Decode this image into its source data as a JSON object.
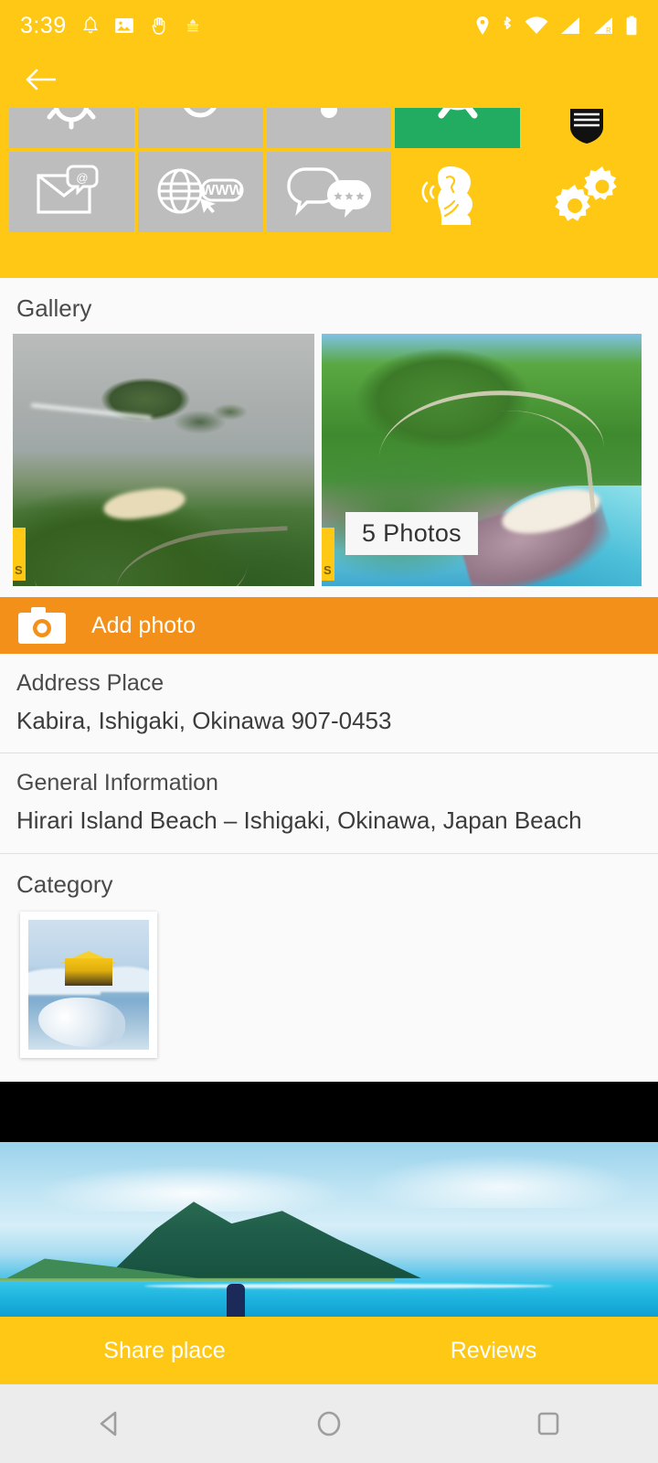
{
  "status_bar": {
    "time": "3:39",
    "left_icons": [
      "bell-icon",
      "image-icon",
      "hand-icon",
      "mosque-app-icon"
    ],
    "right_icons": [
      "location-pin-icon",
      "bluetooth-icon",
      "wifi-icon",
      "signal-icon",
      "signal-roaming-icon",
      "battery-icon"
    ],
    "roaming_label": "R",
    "background_color": "#FFC814"
  },
  "app_bar": {
    "back_label": "Back",
    "background_color": "#FFC814"
  },
  "icon_grid": {
    "row1": [
      {
        "name": "tile-cut-1",
        "icon": "arc-icon",
        "color": "#bdbdbd"
      },
      {
        "name": "tile-cut-2",
        "icon": "circle-icon",
        "color": "#bdbdbd"
      },
      {
        "name": "tile-cut-3",
        "icon": "pin-drop-icon",
        "color": "#bdbdbd"
      },
      {
        "name": "tile-whatsapp",
        "icon": "whatsapp-icon",
        "color": "#22ac62"
      },
      {
        "name": "tile-badge",
        "icon": "shield-badge-icon",
        "color": "#FFC814"
      }
    ],
    "row2": [
      {
        "name": "tile-email",
        "icon": "email-at-icon",
        "color": "#bdbdbd"
      },
      {
        "name": "tile-website",
        "icon": "globe-www-icon",
        "color": "#bdbdbd"
      },
      {
        "name": "tile-reviews",
        "icon": "chat-stars-icon",
        "color": "#bdbdbd"
      },
      {
        "name": "tile-speaker",
        "icon": "person-speaking-icon",
        "color": "#FFC814"
      },
      {
        "name": "tile-settings",
        "icon": "gears-icon",
        "color": "#FFC814"
      }
    ]
  },
  "gallery": {
    "title": "Gallery",
    "photo_count_label": "5 Photos",
    "items": [
      {
        "name": "gallery-photo-1",
        "alt": "Aerial view of island coastline with beach and winding road"
      },
      {
        "name": "gallery-photo-2",
        "alt": "Aerial view of green headland with turquoise sea and rocks"
      }
    ]
  },
  "add_photo": {
    "label": "Add photo",
    "icon": "camera-icon",
    "background_color": "#f39019"
  },
  "address": {
    "title": "Address Place",
    "value": "Kabira, Ishigaki, Okinawa 907-0453"
  },
  "general_information": {
    "title": "General Information",
    "value": "Hirari Island Beach – Ishigaki, Okinawa, Japan Beach"
  },
  "category": {
    "title": "Category",
    "items": [
      {
        "name": "category-thumb-1",
        "alt": "Golden pavilion in snow beside a blue lake"
      }
    ]
  },
  "banner": {
    "alt": "Tropical bay with green mountain and turquoise water"
  },
  "bottom_actions": {
    "share": "Share place",
    "reviews": "Reviews",
    "background_color": "#FFC814"
  },
  "android_nav": {
    "back": "back-triangle-icon",
    "home": "home-circle-icon",
    "recents": "recents-square-icon"
  }
}
